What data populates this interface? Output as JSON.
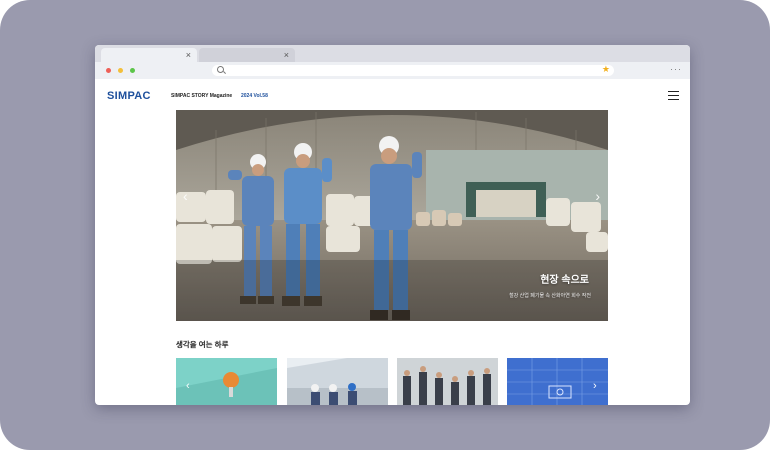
{
  "site": {
    "logo": "SIMPAC",
    "magazine": "SIMPAC STORY Magazine",
    "volume": "2024 Vol.58"
  },
  "browser": {
    "tab_close": "×",
    "menu": "···"
  },
  "hero": {
    "title": "현장 속으로",
    "subtitle": "철강 산업 폐기물 속 산화아연 회수 작전",
    "prev": "‹",
    "next": "›"
  },
  "section": {
    "title": "생각을 여는 하루",
    "prev": "‹",
    "next": "›"
  },
  "colors": {
    "brand": "#1d4f9c",
    "card_teal": "#7dd2c8",
    "card_blue": "#3f6fcf"
  }
}
